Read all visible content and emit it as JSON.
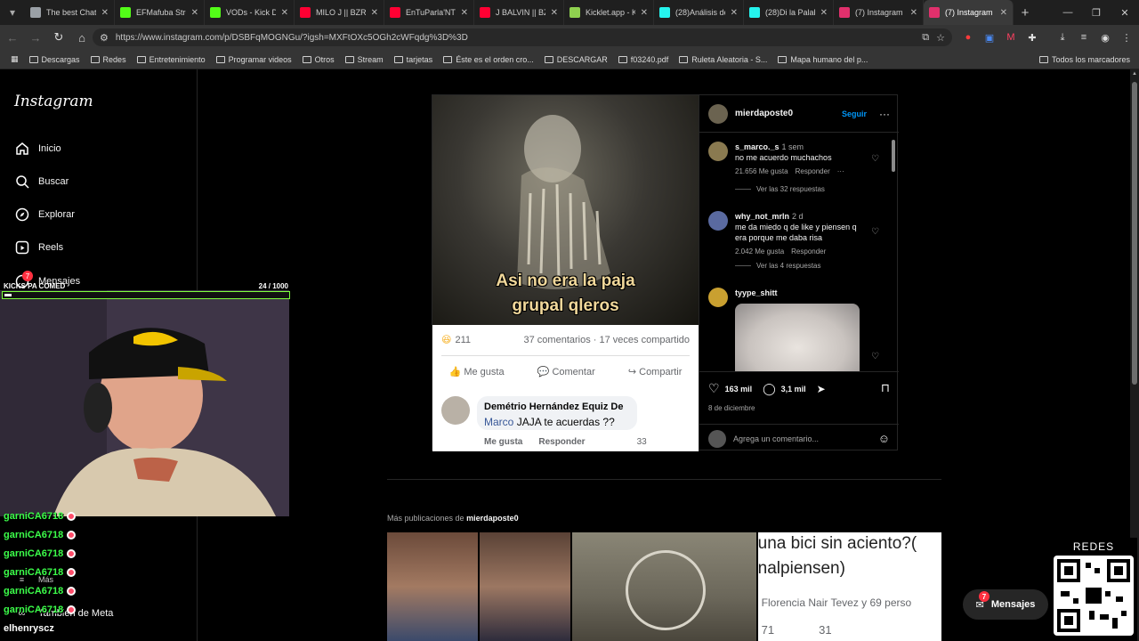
{
  "browser": {
    "tabs": [
      {
        "title": "The best Chat",
        "color": "#9aa0a6"
      },
      {
        "title": "EFMafuba Stre",
        "color": "#53fc18"
      },
      {
        "title": "VODs - Kick Da",
        "color": "#53fc18"
      },
      {
        "title": "MILO J || BZRP",
        "color": "#ff0033"
      },
      {
        "title": "EnTuParla'NT -",
        "color": "#ff0033"
      },
      {
        "title": "J BALVIN || BZR",
        "color": "#ff0033"
      },
      {
        "title": "Kicklet.app - Ki",
        "color": "#8fd14f"
      },
      {
        "title": "(28)Análisis de",
        "color": "#25f4ee"
      },
      {
        "title": "(28)Di la Palabr",
        "color": "#25f4ee"
      },
      {
        "title": "(7) Instagram",
        "color": "#e1306c"
      },
      {
        "title": "(7) Instagram",
        "color": "#e1306c"
      }
    ],
    "url": "https://www.instagram.com/p/DSBFqMOGNGu/?igsh=MXFtOXc5OGh2cWFqdg%3D%3D",
    "bookmarks": [
      "Descargas",
      "Redes",
      "Entretenimiento",
      "Programar videos",
      "Otros",
      "Stream",
      "tarjetas",
      "Éste es el orden cro...",
      "DESCARGAR",
      "f03240.pdf",
      "Ruleta Aleatoria - S...",
      "Mapa humano del p..."
    ],
    "bookmarks_right": "Todos los marcadores"
  },
  "sidebar": {
    "logo": "Instagram",
    "items": [
      {
        "label": "Inicio",
        "icon": "home-icon"
      },
      {
        "label": "Buscar",
        "icon": "search-icon"
      },
      {
        "label": "Explorar",
        "icon": "compass-icon"
      },
      {
        "label": "Reels",
        "icon": "reels-icon"
      },
      {
        "label": "Mensajes",
        "icon": "messenger-icon"
      }
    ],
    "messages_badge": "7",
    "more_label": "Más",
    "meta_label": "También de Meta"
  },
  "post": {
    "meme_caption_line1": "Asi no era la paja",
    "meme_caption_line2": "grupal qleros",
    "fb_reactions": "211",
    "fb_stats": "37 comentarios · 17 veces compartido",
    "fb_like": "Me gusta",
    "fb_comment": "Comentar",
    "fb_share": "Compartir",
    "fb_commenter": "Demétrio Hernández Equiz De",
    "fb_comment_mention": "Marco",
    "fb_comment_text": "JAJA te acuerdas ??",
    "fb_reply_like": "Me gusta",
    "fb_reply": "Responder",
    "fb_reply_count": "33",
    "author": "mierdaposte0",
    "follow": "Seguir",
    "comments": [
      {
        "user": "s_marco._s",
        "time": "1 sem",
        "text": "no me acuerdo muchachos",
        "likes": "21.656 Me gusta",
        "reply": "Responder",
        "replies": "Ver las 32 respuestas"
      },
      {
        "user": "why_not_mrln",
        "time": "2 d",
        "text": "me da miedo q de like y piensen q era porque me daba risa",
        "likes": "2.042 Me gusta",
        "reply": "Responder",
        "replies": "Ver las 4 respuestas"
      },
      {
        "user": "tyype_shitt",
        "time": "",
        "text": "",
        "likes": "",
        "reply": "",
        "replies": ""
      }
    ],
    "like_count": "163 mil",
    "comment_count": "3,1 mil",
    "date": "8 de diciembre",
    "add_comment_placeholder": "Agrega un comentario..."
  },
  "more_posts": {
    "prefix": "Más publicaciones de",
    "author": "mierdaposte0",
    "tile4_line1": "una bici sin aciento?(",
    "tile4_line2": "nalpiensen)",
    "tile4_line3": "Florencia Nair Tevez y 69 perso",
    "tile4_count_a": "71",
    "tile4_count_b": "31"
  },
  "messages_button": {
    "label": "Mensajes",
    "badge": "7"
  },
  "overlay": {
    "goal_label": "KICKS PA COMED",
    "goal_count": "24  /  1000",
    "goal_progress": 0.024,
    "chat_lines": [
      "garniCA6718",
      "garniCA6718",
      "garniCA6718",
      "garniCA6718",
      "garniCA6718",
      "garniCA6718",
      "elhenryscz"
    ],
    "redes_label": "REDES"
  }
}
